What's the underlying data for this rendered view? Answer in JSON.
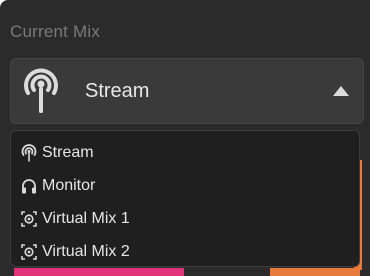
{
  "section": {
    "label": "Current Mix"
  },
  "select": {
    "value": "Stream",
    "icon": "broadcast-icon",
    "expanded": true
  },
  "options": [
    {
      "label": "Stream",
      "icon": "broadcast-icon"
    },
    {
      "label": "Monitor",
      "icon": "headphones-icon"
    },
    {
      "label": "Virtual Mix 1",
      "icon": "virtual-mix-icon"
    },
    {
      "label": "Virtual Mix 2",
      "icon": "virtual-mix-icon"
    }
  ],
  "colors": {
    "panel_bg": "#2b2b2b",
    "dropdown_bg": "#1f1f1f",
    "accent_pink": "#e0337a",
    "accent_orange": "#e6793b"
  }
}
